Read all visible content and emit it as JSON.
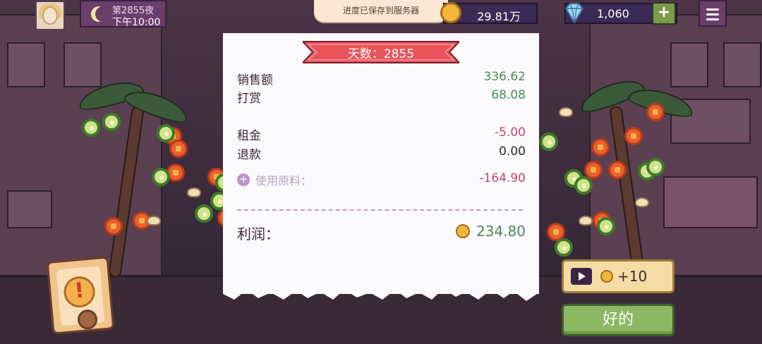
{
  "header": {
    "day_label": "第2855夜",
    "time_label": "下午10:00",
    "toast": "进度已保存到服务器",
    "coins": "29.81万",
    "gems": "1,060",
    "add_gems_label": "+"
  },
  "receipt": {
    "banner": "天数：2855",
    "rows": [
      {
        "label": "销售额",
        "value": "336.62"
      },
      {
        "label": "打赏",
        "value": "68.08"
      },
      {
        "label": "租金",
        "value": "-5.00"
      },
      {
        "label": "退款",
        "value": "0.00"
      }
    ],
    "ingredients_label": "使用原料：",
    "ingredients_value": "-164.90",
    "ingredients_plus": "+",
    "profit_label": "利润：",
    "profit_value": "234.80"
  },
  "actions": {
    "ad_reward": "+10",
    "ok": "好的"
  },
  "alert": {
    "mark": "!"
  },
  "colors": {
    "ribbon": "#e9555d",
    "positive": "#4a8a5a",
    "negative": "#c2466a",
    "ok_button": "#8cb864"
  }
}
